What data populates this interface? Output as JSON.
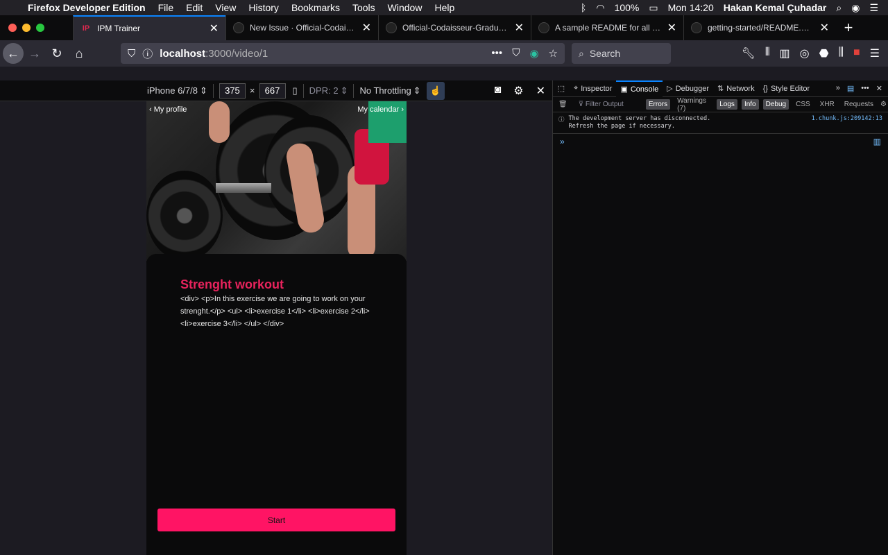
{
  "menubar": {
    "app": "Firefox Developer Edition",
    "menus": [
      "File",
      "Edit",
      "View",
      "History",
      "Bookmarks",
      "Tools",
      "Window",
      "Help"
    ],
    "battery": "100%",
    "clock": "Mon 14:20",
    "user": "Hakan Kemal Çuhadar"
  },
  "tabs": [
    {
      "label": "IPM Trainer",
      "fav": "IP"
    },
    {
      "label": "New Issue · Official-Codaisseur-",
      "fav": ""
    },
    {
      "label": "Official-Codaisseur-Graduate/",
      "fav": ""
    },
    {
      "label": "A sample README for all your",
      "fav": ""
    },
    {
      "label": "getting-started/README.md at",
      "fav": ""
    }
  ],
  "urlbar": {
    "host": "localhost",
    "path": ":3000/video/1",
    "search_placeholder": "Search"
  },
  "rdm": {
    "device": "iPhone 6/7/8",
    "width": "375",
    "height": "667",
    "times": "×",
    "dpr": "DPR: 2",
    "throttling": "No Throttling"
  },
  "app": {
    "profile_link": "My profile",
    "calendar_link": "My calendar",
    "workout_title": "Strenght workout",
    "workout_description": "<div> <p>In this exercise we are going to work on your strenght.</p> <ul> <li>exercise 1</li> <li>exercise 2</li> <li>exercise 3</li> </ul> </div>",
    "start_label": "Start"
  },
  "devtools": {
    "tabs": [
      "Inspector",
      "Console",
      "Debugger",
      "Network",
      "Style Editor"
    ],
    "filter_placeholder": "Filter Output",
    "filters": [
      "Errors",
      "Warnings (7)",
      "Logs",
      "Info",
      "Debug",
      "CSS",
      "XHR",
      "Requests"
    ],
    "message": "The development server has disconnected.\nRefresh the page if necessary.",
    "message_source": "1.chunk.js:209142:13"
  }
}
